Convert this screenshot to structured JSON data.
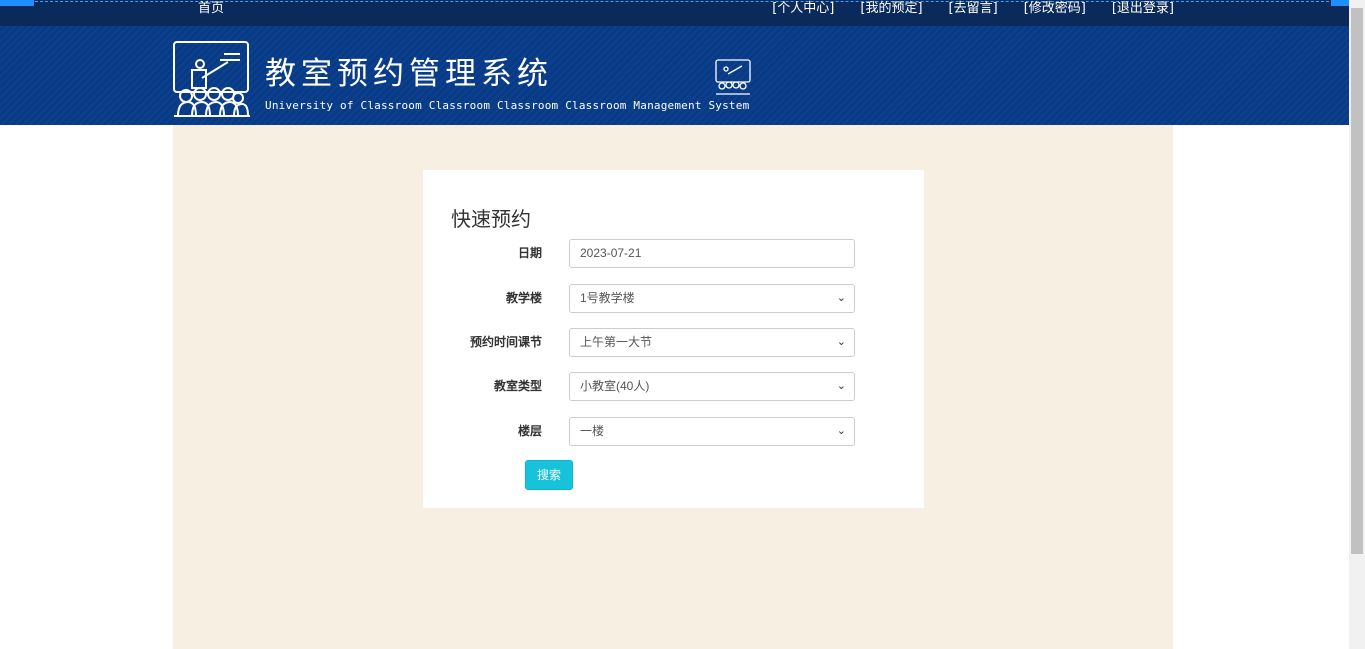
{
  "topnav": {
    "home": "首页",
    "links": [
      "[个人中心]",
      "[我的预定]",
      "[去留言]",
      "[修改密码]",
      "[退出登录]"
    ]
  },
  "banner": {
    "title": "教室预约管理系统",
    "subtitle": "University of Classroom Classroom Classroom Classroom Management System"
  },
  "form": {
    "heading": "快速预约",
    "date": {
      "label": "日期",
      "value": "2023-07-21"
    },
    "building": {
      "label": "教学楼",
      "value": "1号教学楼"
    },
    "period": {
      "label": "预约时间课节",
      "value": "上午第一大节"
    },
    "room_type": {
      "label": "教室类型",
      "value": "小教室(40人)"
    },
    "floor": {
      "label": "楼层",
      "value": "一楼"
    },
    "search_button": "搜索"
  },
  "colors": {
    "topbar": "#0b2a5c",
    "banner": "#073a87",
    "content_bg": "#f8efe3",
    "button": "#17c2db"
  }
}
